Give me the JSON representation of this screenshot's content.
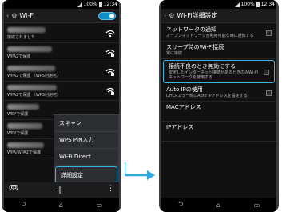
{
  "status": {
    "battery": "100%",
    "time": "12:34"
  },
  "left": {
    "title": "Wi-Fi",
    "networks": [
      {
        "status": "接続されました"
      },
      {
        "status": "WPA2で保護"
      },
      {
        "status": "WPA2で保護 （WPS利用可）"
      },
      {
        "status": "WPA2で保護 （WPS利用可）"
      },
      {
        "status": "WEPで保護"
      },
      {
        "status": "WEPで保護"
      },
      {
        "status": "WPA/WPA2で保護"
      }
    ],
    "menu": [
      "スキャン",
      "WPS PIN入力",
      "Wi-Fi Direct",
      "詳細設定"
    ]
  },
  "right": {
    "title": "Wi-Fi詳細設定",
    "settings": [
      {
        "title": "ネットワークの通知",
        "sub": "オープンネットワークが利用可能な時に通知する"
      },
      {
        "title": "スリープ時のWi-Fi接続",
        "sub": "常に接続"
      },
      {
        "title": "接続不良のとき無効にする",
        "sub": "安定したインターネット接続があるときのみWi-Fiネットワークを使用する"
      },
      {
        "title": "Auto IPの使用",
        "sub": "DHCPエラー時にAuto IPアドレスを設定する"
      },
      {
        "title": "MACアドレス",
        "sub": ""
      },
      {
        "title": "IPアドレス",
        "sub": ""
      }
    ]
  },
  "colors": {
    "accent": "#3ab3e5",
    "toggle": "#0f8fc4"
  }
}
